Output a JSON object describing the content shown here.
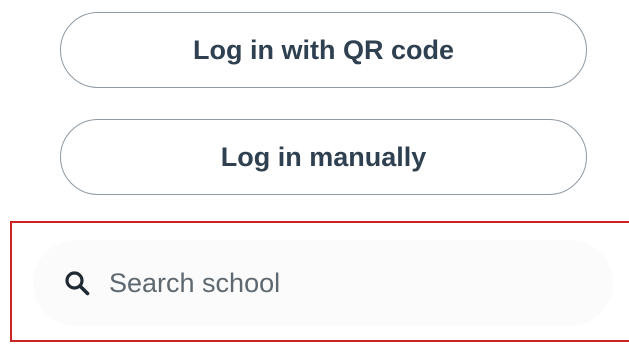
{
  "buttons": {
    "qr_login_label": "Log in with QR code",
    "manual_login_label": "Log in manually"
  },
  "search": {
    "placeholder": "Search school",
    "value": "",
    "icon": "search-icon"
  },
  "colors": {
    "button_text": "#2f4150",
    "button_border": "#8e9aa4",
    "highlight_border": "#cc2222",
    "search_background": "#fbfbfb",
    "placeholder_text": "#5d6870"
  }
}
